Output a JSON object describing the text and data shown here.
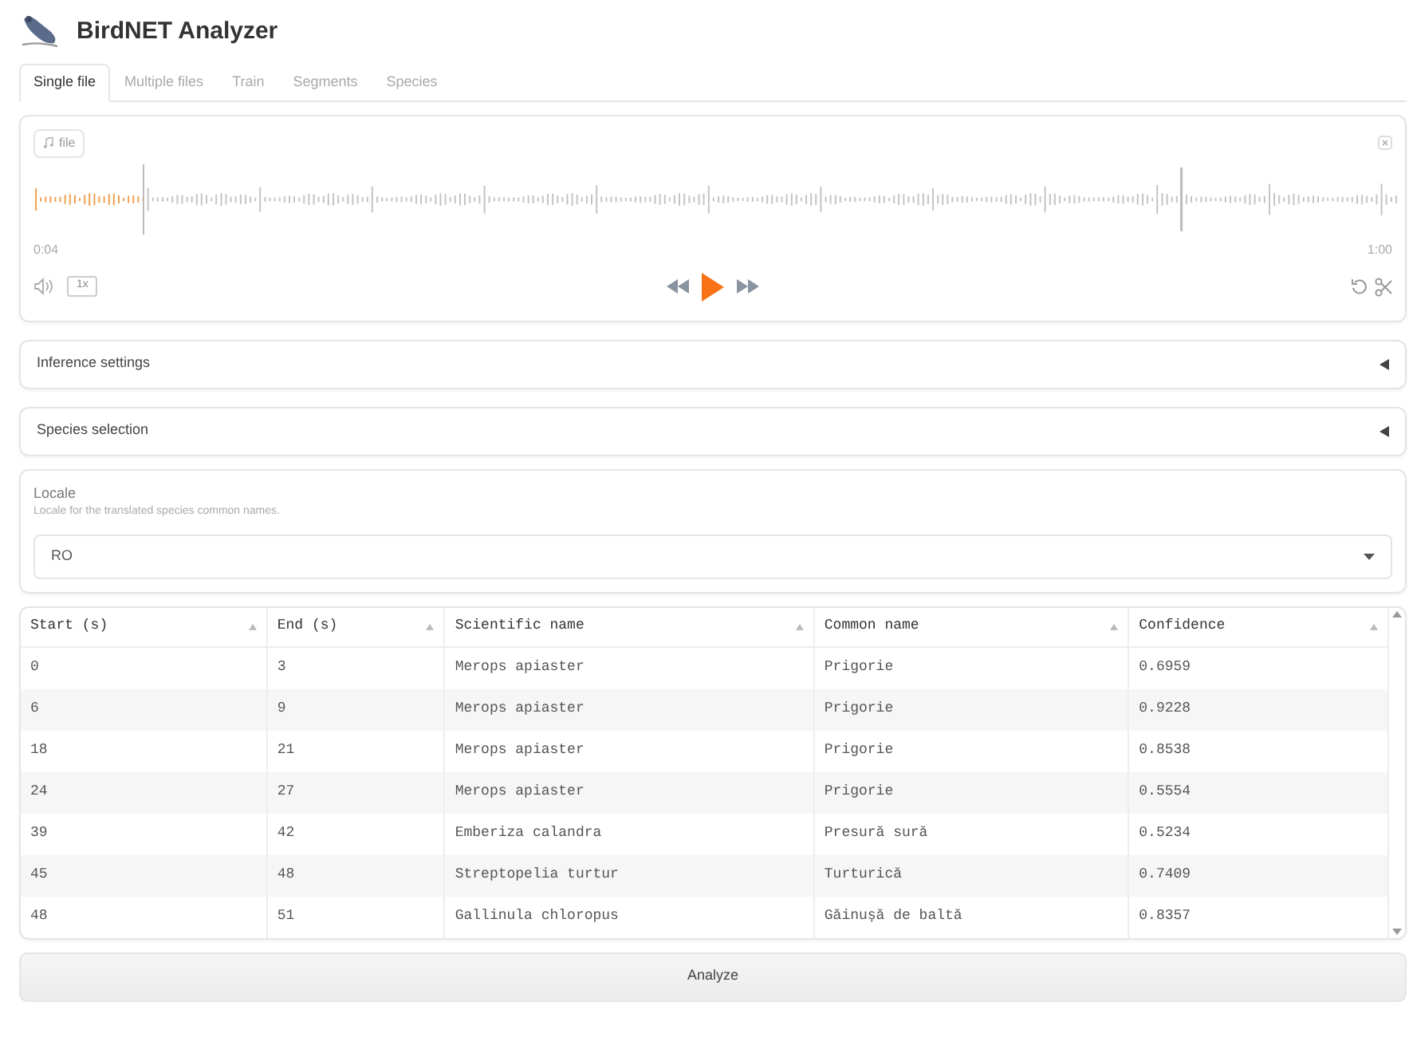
{
  "app": {
    "title": "BirdNET Analyzer"
  },
  "tabs": [
    {
      "label": "Single file",
      "selected": true
    },
    {
      "label": "Multiple files",
      "selected": false
    },
    {
      "label": "Train",
      "selected": false
    },
    {
      "label": "Segments",
      "selected": false
    },
    {
      "label": "Species",
      "selected": false
    }
  ],
  "audio": {
    "label": "file",
    "level": 0.08,
    "current_time": "0:04",
    "duration": "1:00",
    "speed": "1x"
  },
  "accordions": [
    {
      "label": "Inference settings",
      "expanded": false
    },
    {
      "label": "Species selection",
      "expanded": false
    }
  ],
  "locale": {
    "label": "Locale",
    "info": "Locale for the translated species common names.",
    "value": "RO"
  },
  "table": {
    "columns": [
      "Start (s)",
      "End (s)",
      "Scientific name",
      "Common name",
      "Confidence"
    ],
    "rows": [
      [
        "0",
        "3",
        "Merops apiaster",
        "Prigorie",
        "0.6959"
      ],
      [
        "6",
        "9",
        "Merops apiaster",
        "Prigorie",
        "0.9228"
      ],
      [
        "18",
        "21",
        "Merops apiaster",
        "Prigorie",
        "0.8538"
      ],
      [
        "24",
        "27",
        "Merops apiaster",
        "Prigorie",
        "0.5554"
      ],
      [
        "39",
        "42",
        "Emberiza calandra",
        "Presură sură",
        "0.5234"
      ],
      [
        "45",
        "48",
        "Streptopelia turtur",
        "Turturică",
        "0.7409"
      ],
      [
        "48",
        "51",
        "Gallinula chloropus",
        "Găinușă de baltă",
        "0.8357"
      ]
    ]
  },
  "analyze_button": "Analyze"
}
